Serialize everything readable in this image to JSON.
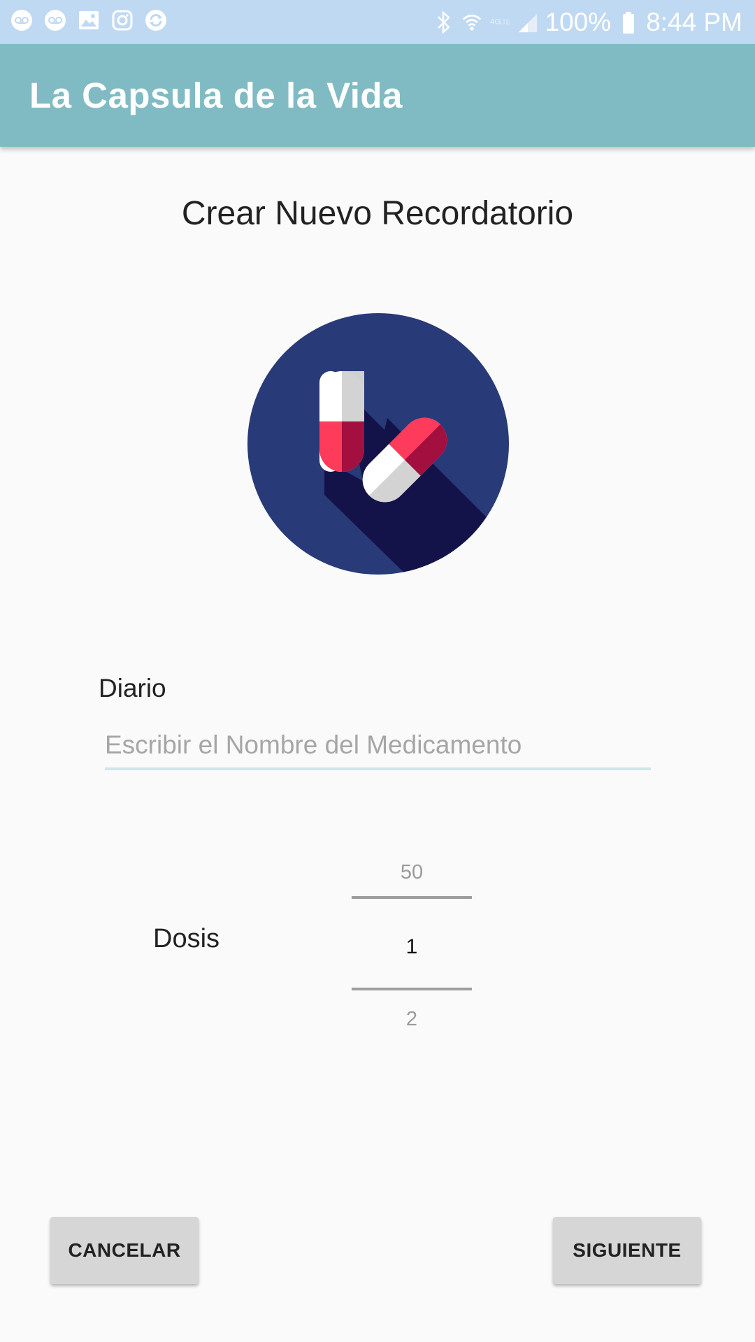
{
  "status_bar": {
    "battery": "100%",
    "time": "8:44 PM",
    "left_icons": [
      "voicemail-icon",
      "voicemail-icon",
      "gallery-icon",
      "instagram-icon",
      "sync-icon"
    ],
    "right_icons": [
      "bluetooth-icon",
      "wifi-icon",
      "lte-icon",
      "signal-icon",
      "battery-icon"
    ],
    "background": "#bfd9f2"
  },
  "app_bar": {
    "title": "La Capsula de la Vida",
    "color": "#80bbc3"
  },
  "main": {
    "heading": "Crear Nuevo Recordatorio",
    "logo_icon": "pills-icon",
    "frequency_label": "Diario",
    "medication_input": {
      "value": "",
      "placeholder": "Escribir el Nombre del Medicamento"
    },
    "dose_label": "Dosis",
    "dose_picker": {
      "previous": "50",
      "current": "1",
      "next": "2"
    }
  },
  "buttons": {
    "cancel": "CANCELAR",
    "next": "SIGUIENTE"
  }
}
